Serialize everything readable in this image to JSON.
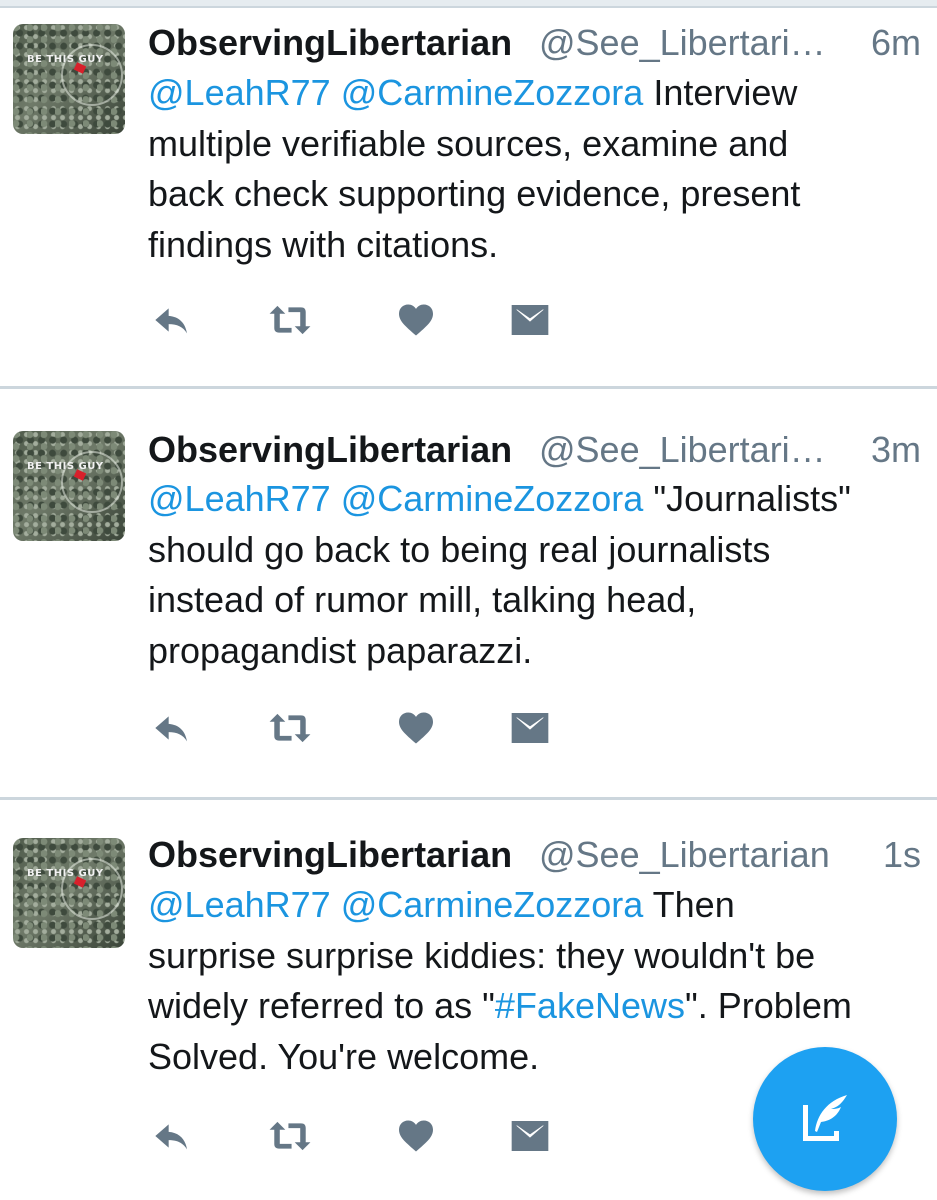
{
  "colors": {
    "link": "#1b95e0",
    "muted": "#657786",
    "divider": "#ccd6dd",
    "fab": "#1da1f2"
  },
  "tweets": [
    {
      "name": "ObservingLibertarian",
      "handle": "@See_Libertari…",
      "time": "6m",
      "avatar_text": "BE THIS GUY",
      "mentions": [
        "@LeahR77",
        "@CarmineZozzora"
      ],
      "text_lines": [
        "Interview",
        "multiple verifiable sources, examine and",
        "back check supporting evidence, present",
        "findings with citations."
      ],
      "actions": [
        "reply-icon",
        "retweet-icon",
        "like-icon",
        "direct-message-icon"
      ]
    },
    {
      "name": "ObservingLibertarian",
      "handle": "@See_Libertari…",
      "time": "3m",
      "avatar_text": "BE THIS GUY",
      "mentions": [
        "@LeahR77",
        "@CarmineZozzora"
      ],
      "text_lines": [
        "\"Journalists\"",
        "should go back to being real journalists",
        "instead of rumor mill, talking head,",
        "propagandist paparazzi."
      ],
      "actions": [
        "reply-icon",
        "retweet-icon",
        "like-icon",
        "direct-message-icon"
      ]
    },
    {
      "name": "ObservingLibertarian",
      "handle": "@See_Libertarian",
      "time": "1s",
      "avatar_text": "BE THIS GUY",
      "mentions": [
        "@LeahR77",
        "@CarmineZozzora"
      ],
      "text_line1_tail": "Then",
      "text_line2": "surprise surprise kiddies: they wouldn't be",
      "text_line3_before": "widely referred to as \"",
      "hashtag": "#FakeNews",
      "text_line3_after": "\". Problem",
      "text_line4": "Solved. You're welcome.",
      "actions": [
        "reply-icon",
        "retweet-icon",
        "like-icon",
        "direct-message-icon"
      ]
    }
  ],
  "fab": {
    "icon": "compose-tweet-icon"
  }
}
